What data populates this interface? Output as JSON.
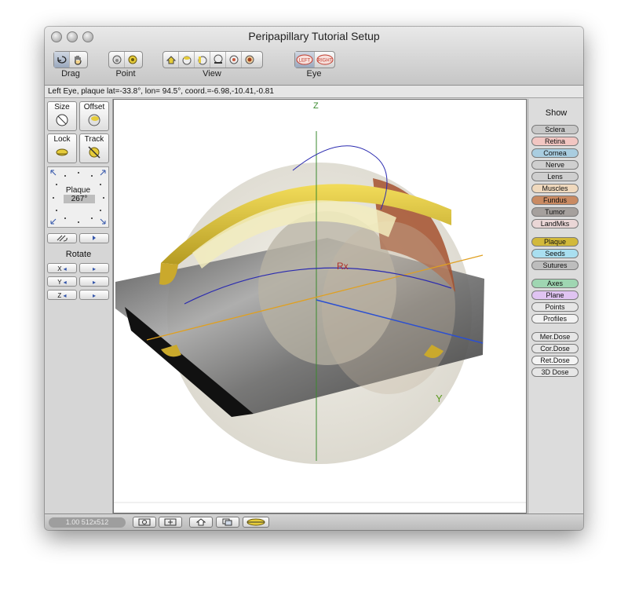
{
  "window": {
    "title": "Peripapillary Tutorial Setup"
  },
  "toolbar": {
    "groups": [
      {
        "label": "Drag",
        "buttons": [
          "rotate-drag",
          "hand-drag"
        ]
      },
      {
        "label": "Point",
        "buttons": [
          "point-eye",
          "point-camera"
        ]
      },
      {
        "label": "View",
        "buttons": [
          "home-view",
          "top-view",
          "side-view",
          "bottom-view",
          "front-view",
          "back-view"
        ]
      },
      {
        "label": "Eye",
        "buttons": [
          "LEFT",
          "RIGHT"
        ]
      }
    ]
  },
  "status": {
    "text": "Left Eye, plaque lat=-33.8°, lon= 94.5°, coord.=-6.98,-10.41,-0.81"
  },
  "left_panel": {
    "size_label": "Size",
    "offset_label": "Offset",
    "lock_label": "Lock",
    "track_label": "Track",
    "dial_title": "Plaque",
    "dial_value": "267°",
    "rotate_label": "Rotate",
    "axes": [
      "X",
      "Y",
      "Z"
    ]
  },
  "viewport": {
    "marker_rx": "Rx",
    "axis_y": "Y",
    "axis_z": "Z"
  },
  "right_panel": {
    "show_label": "Show",
    "groups": [
      [
        {
          "label": "Sclera",
          "color": "#c8c8c8"
        },
        {
          "label": "Retina",
          "color": "#f2c6c2"
        },
        {
          "label": "Cornea",
          "color": "#a9cde0"
        },
        {
          "label": "Nerve",
          "color": "#cfcfcf"
        },
        {
          "label": "Lens",
          "color": "#cfcfcf"
        },
        {
          "label": "Muscles",
          "color": "#f0d9bd"
        },
        {
          "label": "Fundus",
          "color": "#c98a62"
        },
        {
          "label": "Tumor",
          "color": "#a5a09d"
        },
        {
          "label": "LandMks",
          "color": "#ead6d6"
        }
      ],
      [
        {
          "label": "Plaque",
          "color": "#d2b93b"
        },
        {
          "label": "Seeds",
          "color": "#a9dff0"
        },
        {
          "label": "Sutures",
          "color": "#bdbdbd"
        }
      ],
      [
        {
          "label": "Axes",
          "color": "#9fd6b2"
        },
        {
          "label": "Plane",
          "color": "#e0c4f2"
        },
        {
          "label": "Points",
          "color": "#e6e6e6"
        },
        {
          "label": "Profiles",
          "color": "#f2f2f2"
        }
      ],
      [
        {
          "label": "Mer.Dose",
          "color": "#e6e6e6"
        },
        {
          "label": "Cor.Dose",
          "color": "#e6e6e6"
        },
        {
          "label": "Ret.Dose",
          "color": "#f4f4f4"
        },
        {
          "label": "3D Dose",
          "color": "#e6e6e6"
        }
      ]
    ]
  },
  "bottom_bar": {
    "zoom_text": "1.00 512x512"
  }
}
